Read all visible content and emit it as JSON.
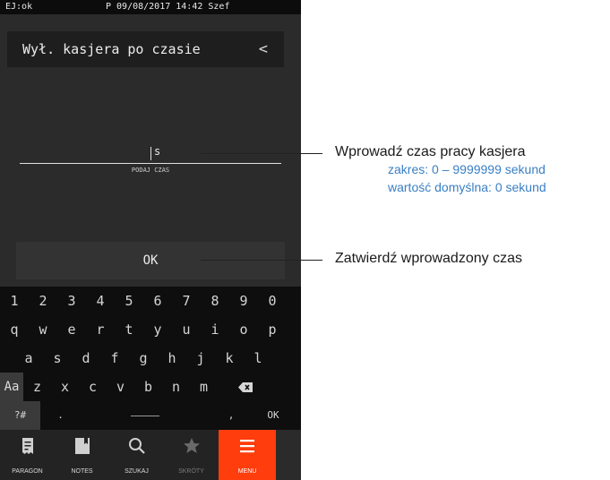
{
  "status_bar": {
    "left": "EJ:ok",
    "center": "P 09/08/2017 14:42 Szef"
  },
  "header": {
    "title": "Wył. kasjera po czasie",
    "back_glyph": "<"
  },
  "input": {
    "value": "s",
    "hint": "PODAJ CZAS"
  },
  "ok_button": {
    "label": "OK"
  },
  "keyboard": {
    "row1": [
      "1",
      "2",
      "3",
      "4",
      "5",
      "6",
      "7",
      "8",
      "9",
      "0"
    ],
    "row2": [
      "q",
      "w",
      "e",
      "r",
      "t",
      "y",
      "u",
      "i",
      "o",
      "p"
    ],
    "row3": [
      "a",
      "s",
      "d",
      "f",
      "g",
      "h",
      "j",
      "k",
      "l"
    ],
    "row4": [
      "Aa",
      "z",
      "x",
      "c",
      "v",
      "b",
      "n",
      "m"
    ],
    "row5": {
      "symbols": "?#",
      "dot": ".",
      "comma": ",",
      "ok": "OK"
    },
    "backspace_icon": "backspace-icon"
  },
  "nav": [
    {
      "label": "PARAGON",
      "icon": "receipt-icon"
    },
    {
      "label": "NOTES",
      "icon": "notebook-icon"
    },
    {
      "label": "SZUKAJ",
      "icon": "search-icon"
    },
    {
      "label": "SKRÓTY",
      "icon": "star-icon"
    },
    {
      "label": "MENU",
      "icon": "menu-icon"
    }
  ],
  "callouts": {
    "input_title": "Wprowadź czas pracy kasjera",
    "input_range": "zakres: 0 – 9999999 sekund",
    "input_default": "wartość domyślna: 0 sekund",
    "ok_title": "Zatwierdź wprowadzony czas"
  },
  "colors": {
    "accent": "#ff3d0d",
    "callout_blue": "#3a7fc4",
    "screen_bg": "#2b2b2b"
  }
}
